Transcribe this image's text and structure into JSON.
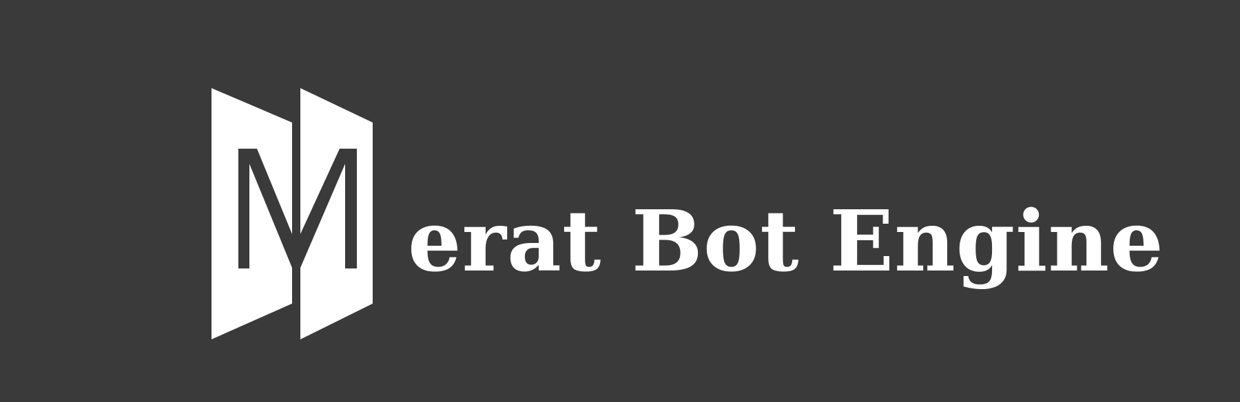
{
  "brand": {
    "name_suffix": "erat Bot Engine",
    "background_color": "#3a3a3a",
    "foreground_color": "#ffffff",
    "logo_icon": "book-m-monogram"
  }
}
